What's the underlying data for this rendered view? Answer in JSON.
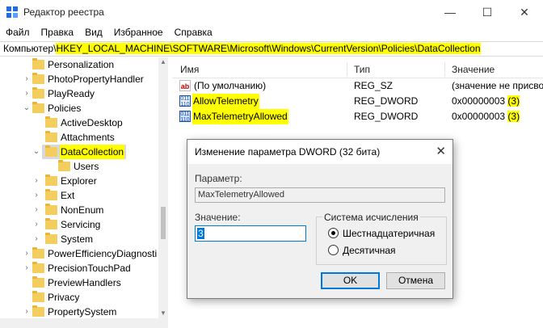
{
  "window": {
    "title": "Редактор реестра",
    "minimize_glyph": "—",
    "maximize_glyph": "☐",
    "close_glyph": "✕"
  },
  "menu": [
    "Файл",
    "Правка",
    "Вид",
    "Избранное",
    "Справка"
  ],
  "address": {
    "prefix": "Компьютер\\",
    "path": "HKEY_LOCAL_MACHINE\\SOFTWARE\\Microsoft\\Windows\\CurrentVersion\\Policies\\DataCollection"
  },
  "tree": [
    {
      "label": "Personalization",
      "arrow": "›"
    },
    {
      "label": "PhotoPropertyHandler",
      "arrow": "›"
    },
    {
      "label": "PlayReady",
      "arrow": "›"
    },
    {
      "label": "Policies",
      "arrow": "⌄"
    },
    {
      "label": "ActiveDesktop",
      "arrow": ""
    },
    {
      "label": "Attachments",
      "arrow": ""
    },
    {
      "label": "DataCollection",
      "arrow": "⌄",
      "selected": true
    },
    {
      "label": "Users",
      "arrow": ""
    },
    {
      "label": "Explorer",
      "arrow": "›"
    },
    {
      "label": "Ext",
      "arrow": "›"
    },
    {
      "label": "NonEnum",
      "arrow": "›"
    },
    {
      "label": "Servicing",
      "arrow": "›"
    },
    {
      "label": "System",
      "arrow": "›"
    },
    {
      "label": "PowerEfficiencyDiagnosti",
      "arrow": "›"
    },
    {
      "label": "PrecisionTouchPad",
      "arrow": "›"
    },
    {
      "label": "PreviewHandlers",
      "arrow": ""
    },
    {
      "label": "Privacy",
      "arrow": ""
    },
    {
      "label": "PropertySystem",
      "arrow": "›"
    }
  ],
  "list": {
    "columns": [
      "Имя",
      "Тип",
      "Значение"
    ],
    "rows": [
      {
        "icon": "ab",
        "name": "(По умолчанию)",
        "type": "REG_SZ",
        "value": "(значение не присво",
        "value_suffix": "",
        "highlight": false
      },
      {
        "icon": "bin",
        "name": "AllowTelemetry",
        "type": "REG_DWORD",
        "value": "0x00000003 ",
        "value_suffix": "(3)",
        "highlight": true
      },
      {
        "icon": "bin",
        "name": "MaxTelemetryAllowed",
        "type": "REG_DWORD",
        "value": "0x00000003 ",
        "value_suffix": "(3)",
        "highlight": true
      }
    ]
  },
  "dialog": {
    "title": "Изменение параметра DWORD (32 бита)",
    "close_glyph": "✕",
    "param_label": "Параметр:",
    "param_value": "MaxTelemetryAllowed",
    "value_label": "Значение:",
    "value": "3",
    "base_group_label": "Система исчисления",
    "radio_hex": "Шестнадцатеричная",
    "radio_dec": "Десятичная",
    "selected_base": "hex",
    "ok_label": "OK",
    "cancel_label": "Отмена"
  },
  "colors": {
    "highlight": "#ffff00",
    "accent": "#0078d7",
    "folder": "#f3cd5d"
  }
}
